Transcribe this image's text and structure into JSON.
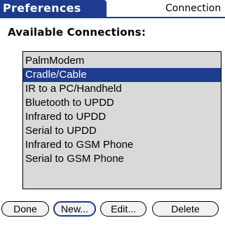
{
  "title_bar": {
    "title": "Preferences",
    "category": "Connection"
  },
  "heading": "Available Connections:",
  "connections": {
    "items": [
      "PalmModem",
      "Cradle/Cable",
      "IR to a PC/Handheld",
      "Bluetooth to UPDD",
      "Infrared to UPDD",
      "Serial to UPDD",
      "Infrared to GSM Phone",
      "Serial to GSM Phone"
    ],
    "selected": "Cradle/Cable"
  },
  "buttons": {
    "done": "Done",
    "new": "New...",
    "edit": "Edit...",
    "delete": "Delete"
  },
  "colors": {
    "accent": "#1d3c8f",
    "list_background": "#d9d9d9",
    "background": "#ffffff"
  }
}
